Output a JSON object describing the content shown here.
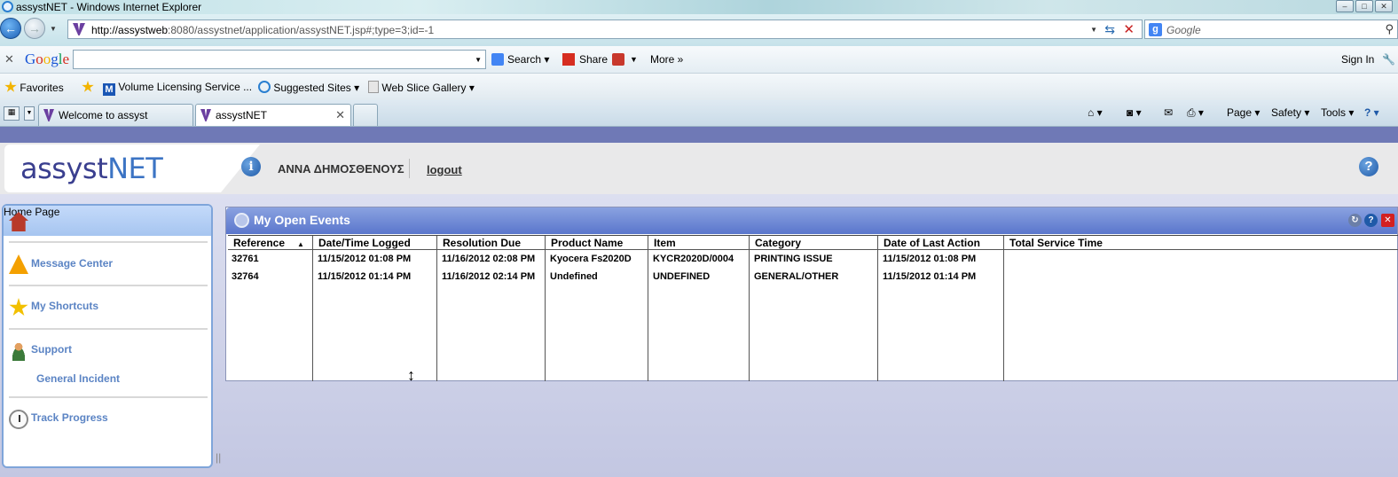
{
  "window": {
    "title": "assystNET - Windows Internet Explorer"
  },
  "address_bar": {
    "url_host": "http://assystweb",
    "url_rest": ":8080/assystnet/application/assystNET.jsp#;type=3;id=-1",
    "search_placeholder": "Google"
  },
  "google_toolbar": {
    "logo_letters": [
      "G",
      "o",
      "o",
      "g",
      "l",
      "e"
    ],
    "search_label": "Search",
    "share_label": "Share",
    "more_label": "More »",
    "sign_in_label": "Sign In"
  },
  "favorites_bar": {
    "favorites_label": "Favorites",
    "items": [
      "Volume Licensing Service ...",
      "Suggested Sites",
      "Web Slice Gallery"
    ]
  },
  "tabs": [
    {
      "label": "Welcome to assyst",
      "active": false
    },
    {
      "label": "assystNET",
      "active": true
    }
  ],
  "command_bar": {
    "page_label": "Page",
    "safety_label": "Safety",
    "tools_label": "Tools"
  },
  "app_header": {
    "logo_a": "assyst",
    "logo_b": "NET",
    "username": "ΑΝΝΑ ΔΗΜΟΣΘΕΝΟΥΣ",
    "logout_label": "logout"
  },
  "left_nav": {
    "items": [
      {
        "label": "Home Page",
        "icon": "home-icon",
        "selected": true
      },
      {
        "label": "Message Center",
        "icon": "warning-icon"
      },
      {
        "label": "My Shortcuts",
        "icon": "star-icon"
      },
      {
        "label": "Support",
        "icon": "people-icon"
      },
      {
        "label": "General Incident",
        "icon": ""
      },
      {
        "label": "Track Progress",
        "icon": "clock-icon"
      }
    ]
  },
  "events_panel": {
    "title": "My Open Events",
    "columns": [
      "Reference",
      "Date/Time Logged",
      "Resolution Due",
      "Product Name",
      "Item",
      "Category",
      "Date of Last Action",
      "Total Service Time"
    ],
    "sort_column": "Reference",
    "rows": [
      [
        "32761",
        "11/15/2012 01:08 PM",
        "11/16/2012 02:08 PM",
        "Kyocera Fs2020D",
        "KYCR2020D/0004",
        "PRINTING ISSUE",
        "11/15/2012 01:08 PM",
        ""
      ],
      [
        "32764",
        "11/15/2012 01:14 PM",
        "11/16/2012 02:14 PM",
        "Undefined",
        "UNDEFINED",
        "GENERAL/OTHER",
        "11/15/2012 01:14 PM",
        ""
      ]
    ]
  },
  "colors": {
    "accent": "#5a76cc",
    "separator": "#6f79b6",
    "nav_link": "#5b84c4"
  }
}
